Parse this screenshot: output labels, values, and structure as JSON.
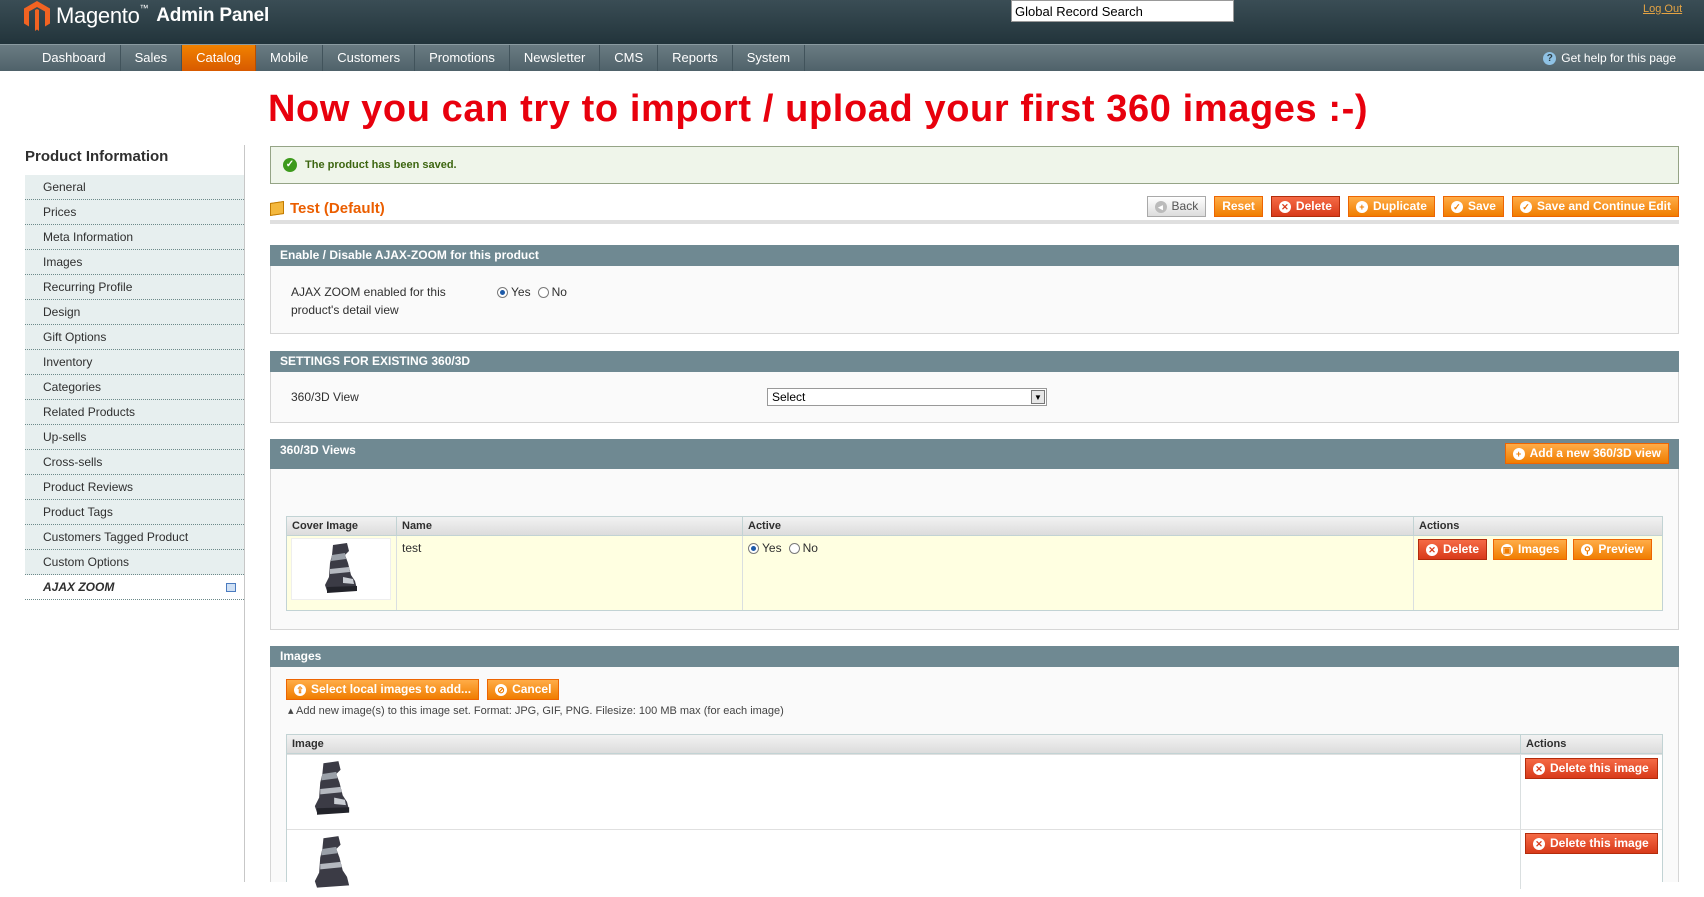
{
  "header": {
    "logo_text": "Magento",
    "logo_tm": "™",
    "logo_sub": "Admin Panel",
    "search_value": "Global Record Search",
    "logout": "Log Out"
  },
  "nav": {
    "items": [
      "Dashboard",
      "Sales",
      "Catalog",
      "Mobile",
      "Customers",
      "Promotions",
      "Newsletter",
      "CMS",
      "Reports",
      "System"
    ],
    "active": "Catalog",
    "help": "Get help for this page"
  },
  "headline": "Now you can try to import / upload your first 360 images :-)",
  "sidebar": {
    "title": "Product Information",
    "items": [
      "General",
      "Prices",
      "Meta Information",
      "Images",
      "Recurring Profile",
      "Design",
      "Gift Options",
      "Inventory",
      "Categories",
      "Related Products",
      "Up-sells",
      "Cross-sells",
      "Product Reviews",
      "Product Tags",
      "Customers Tagged Product",
      "Custom Options",
      "AJAX ZOOM"
    ]
  },
  "message": "The product has been saved.",
  "page": {
    "title": "Test (Default)",
    "buttons": {
      "back": "Back",
      "reset": "Reset",
      "delete": "Delete",
      "duplicate": "Duplicate",
      "save": "Save",
      "save_continue": "Save and Continue Edit"
    }
  },
  "enable_section": {
    "title": "Enable / Disable AJAX-ZOOM for this product",
    "label_line1": "AJAX ZOOM enabled for this",
    "label_line2": "product's detail view",
    "yes": "Yes",
    "no": "No",
    "selected": "Yes"
  },
  "settings_section": {
    "title": "SETTINGS FOR EXISTING 360/3D",
    "label": "360/3D View",
    "select_value": "Select"
  },
  "views_section": {
    "title": "360/3D Views",
    "add_button": "Add a new 360/3D view",
    "columns": [
      "Cover Image",
      "Name",
      "Active",
      "Actions"
    ],
    "row": {
      "name": "test",
      "yes": "Yes",
      "no": "No",
      "active": "Yes",
      "delete": "Delete",
      "images": "Images",
      "preview": "Preview"
    }
  },
  "images_section": {
    "title": "Images",
    "select_button": "Select local images to add...",
    "cancel_button": "Cancel",
    "hint": "Add new image(s) to this image set. Format: JPG, GIF, PNG. Filesize: 100 MB max (for each image)",
    "columns": [
      "Image",
      "Actions"
    ],
    "delete_button": "Delete this image"
  },
  "colors": {
    "accent": "#eb5e00",
    "header": "#2c3e45",
    "section": "#6f8992",
    "headline": "#e8000d"
  }
}
